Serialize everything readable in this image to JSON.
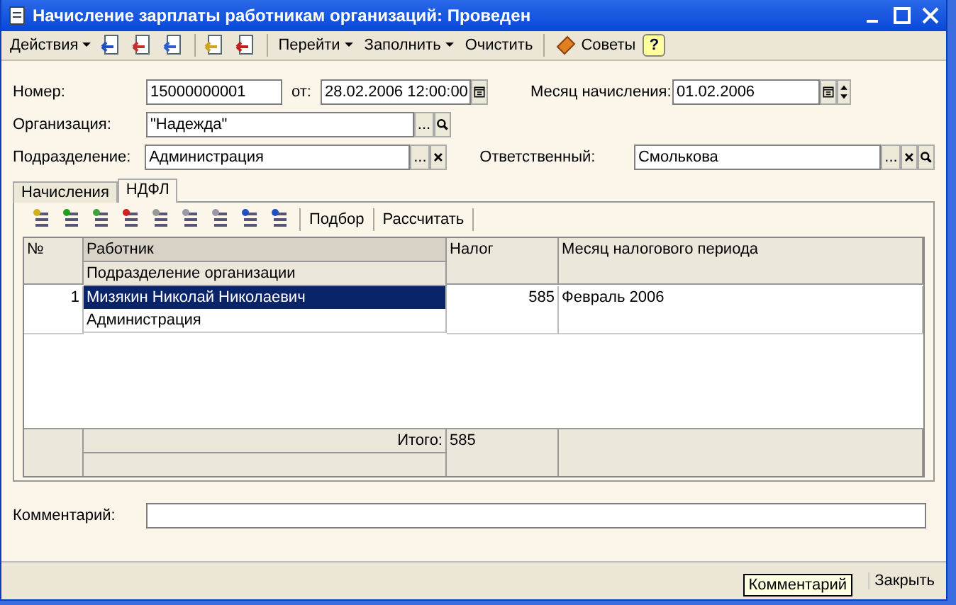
{
  "window": {
    "title": "Начисление зарплаты работникам организаций: Проведен"
  },
  "toolbar": [
    {
      "kind": "menu",
      "label": "Действия"
    },
    {
      "kind": "icon"
    },
    {
      "kind": "icon"
    },
    {
      "kind": "icon"
    },
    {
      "kind": "sep"
    },
    {
      "kind": "icon"
    },
    {
      "kind": "icon"
    },
    {
      "kind": "sep"
    },
    {
      "kind": "menu",
      "label": "Перейти"
    },
    {
      "kind": "menu",
      "label": "Заполнить"
    },
    {
      "kind": "button",
      "label": "Очистить"
    },
    {
      "kind": "sep"
    },
    {
      "kind": "tips",
      "label": "Советы"
    },
    {
      "kind": "help",
      "label": "?"
    }
  ],
  "form": {
    "number_label": "Номер:",
    "number": "15000000001",
    "date_label": "от:",
    "date": "28.02.2006 12:00:00",
    "month_label": "Месяц начисления:",
    "month": "01.02.2006",
    "org_label": "Организация:",
    "org": "\"Надежда\"",
    "dept_label": "Подразделение:",
    "dept": "Администрация",
    "resp_label": "Ответственный:",
    "resp": "Смолькова",
    "select_button": "..."
  },
  "tabs": [
    {
      "label": "Начисления",
      "selected": false
    },
    {
      "label": "НДФЛ",
      "selected": true
    }
  ],
  "table_toolbar": [
    "Подбор",
    "Рассчитать"
  ],
  "table": {
    "columns": [
      {
        "label": "№"
      },
      {
        "label": "Работник",
        "sublabel": "Подразделение организации"
      },
      {
        "label": "Налог"
      },
      {
        "label": "Месяц налогового периода"
      }
    ],
    "rows": [
      {
        "n": "1",
        "worker": "Мизякин Николай Николаевич",
        "dept": "Администрация",
        "tax": "585",
        "month": "Февраль 2006",
        "selected": true
      }
    ],
    "total_label": "Итого:",
    "total": "585"
  },
  "comment": {
    "label": "Комментарий:"
  },
  "buttons": [
    {
      "label": "Закрыть"
    }
  ],
  "tooltip": "Комментарий"
}
